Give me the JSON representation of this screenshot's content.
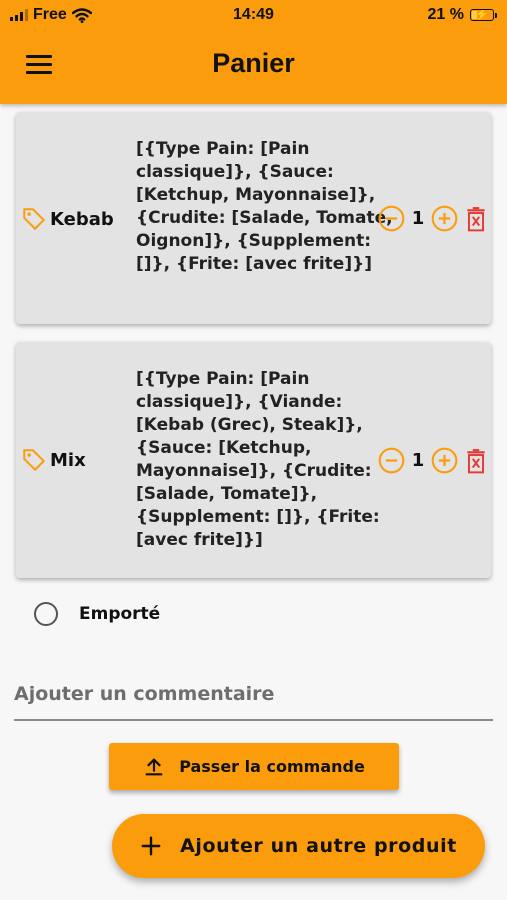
{
  "status_bar": {
    "carrier": "Free",
    "time": "14:49",
    "battery": "21 %",
    "battery_level": 0.21,
    "icons": [
      "signal-icon",
      "wifi-icon",
      "battery-icon"
    ]
  },
  "header": {
    "title": "Panier",
    "menu_icon": "menu-icon"
  },
  "cart": {
    "items": [
      {
        "name": "Kebab",
        "description": "[{Type Pain: [Pain classique]}, {Sauce: [Ketchup, Mayonnaise]}, {Crudite: [Salade, Tomate, Oignon]}, {Supplement: []}, {Frite: [avec frite]}]",
        "quantity": "1"
      },
      {
        "name": "Mix",
        "description": "[{Type Pain: [Pain classique]}, {Viande: [Kebab (Grec), Steak]}, {Sauce: [Ketchup, Mayonnaise]}, {Crudite: [Salade, Tomate]}, {Supplement: []}, {Frite: [avec frite]}]",
        "quantity": "1"
      }
    ]
  },
  "takeaway": {
    "label": "Emporté",
    "selected": false
  },
  "comment": {
    "placeholder": "Ajouter un commentaire",
    "value": ""
  },
  "actions": {
    "submit_label": "Passer la commande",
    "add_product_label": "Ajouter un autre produit"
  },
  "colors": {
    "accent": "#fb9c0c",
    "card": "#e3e3e3",
    "delete": "#e53935",
    "background": "#f7f7f7"
  }
}
